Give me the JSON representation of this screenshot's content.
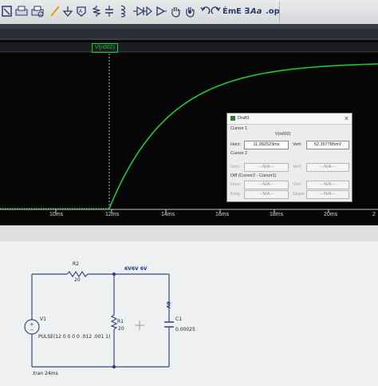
{
  "toolbar": {
    "text_tool": "Ėm",
    "spice_directive": "E ∃",
    "font_label": "Aa",
    "op_label": ".op"
  },
  "plot": {
    "trace_label": "V(n002)",
    "trace_color": "#1ec83a",
    "x_ticks": [
      "10ms",
      "12ms",
      "14ms",
      "16ms",
      "18ms",
      "20ms",
      "2"
    ]
  },
  "cursor_dialog": {
    "title": "Draft1",
    "cursor1_label": "Cursor 1",
    "cursor1_trace": "V(n002)",
    "horz_label": "Horz:",
    "horz_value": "11.992523ms",
    "vert_label": "Vert:",
    "vert_value": "52.357785mV",
    "cursor2_label": "Cursor 2",
    "c2_horz_label": "Horz:",
    "c2_horz_value": "---N/A---",
    "c2_vert_label": "Vert:",
    "c2_vert_value": "---N/A---",
    "diff_label": "Diff (Cursor2 - Cursor1)",
    "diff_horz_label": "Horz:",
    "diff_horz_value": "---N/A---",
    "diff_vert_label": "Vert:",
    "diff_vert_value": "---N/A---",
    "freq_label": "Freq:",
    "freq_value": "---N/A---",
    "slope_label": "Slope:",
    "slope_value": "---N/A---"
  },
  "schematic": {
    "r2_name": "R2",
    "r2_value": "20",
    "node_label": "6V6V 6V",
    "v1_name": "V1",
    "v1_value": "PULSE(12 0 0 0 0 .012 .001 1)",
    "r1_name": "R1",
    "r1_value": "20",
    "c1_name": "C1",
    "c1_value": "0.00025",
    "cap_voltage": "6V",
    "tran": ".tran 24ms"
  }
}
